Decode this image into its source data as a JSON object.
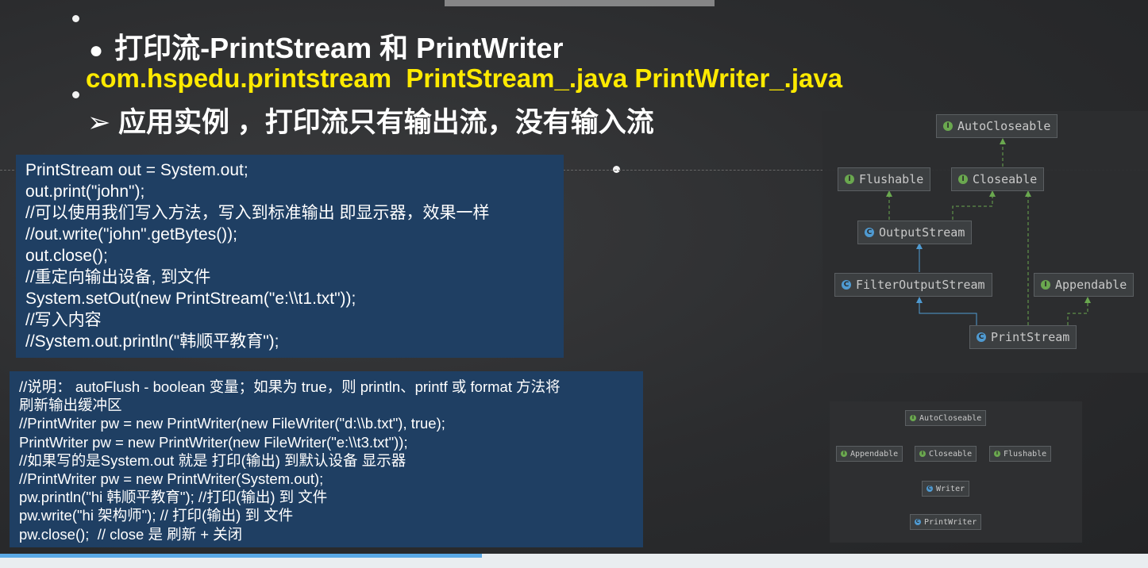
{
  "slide": {
    "title": "打印流-PrintStream 和 PrintWriter",
    "title_bullet": "●",
    "files": "com.hspedu.printstream  PrintStream_.java PrintWriter_.java",
    "subtitle": "➢ 应用实例 ，打印流只有输出流，没有输入流"
  },
  "code_block_1": {
    "lines": [
      "PrintStream out = System.out;",
      "out.print(\"john\");",
      "//可以使用我们写入方法，写入到标准输出 即显示器，效果一样",
      "//out.write(\"john\".getBytes());",
      "out.close();",
      "//重定向输出设备, 到文件",
      "System.setOut(new PrintStream(\"e:\\\\t1.txt\"));",
      "//写入内容",
      "//System.out.println(\"韩顺平教育\");"
    ]
  },
  "code_block_2": {
    "lines": [
      "//说明： autoFlush - boolean 变量；如果为 true，则 println、printf 或 format 方法将",
      "刷新输出缓冲区",
      "//PrintWriter pw = new PrintWriter(new FileWriter(\"d:\\\\b.txt\"), true);",
      "PrintWriter pw = new PrintWriter(new FileWriter(\"e:\\\\t3.txt\"));",
      "//如果写的是System.out 就是 打印(输出) 到默认设备 显示器",
      "//PrintWriter pw = new PrintWriter(System.out);",
      "pw.println(\"hi 韩顺平教育\"); //打印(输出) 到 文件",
      "pw.write(\"hi 架构师\"); // 打印(输出) 到 文件",
      "pw.close();  // close 是 刷新 + 关闭"
    ]
  },
  "diagram_1": {
    "nodes": {
      "autocloseable": {
        "label": "AutoCloseable",
        "kind": "I"
      },
      "flushable": {
        "label": "Flushable",
        "kind": "I"
      },
      "closeable": {
        "label": "Closeable",
        "kind": "I"
      },
      "outputstream": {
        "label": "OutputStream",
        "kind": "C"
      },
      "filteroutputstream": {
        "label": "FilterOutputStream",
        "kind": "C"
      },
      "appendable": {
        "label": "Appendable",
        "kind": "I"
      },
      "printstream": {
        "label": "PrintStream",
        "kind": "C"
      }
    }
  },
  "diagram_2": {
    "nodes": {
      "autocloseable": {
        "label": "AutoCloseable",
        "kind": "I"
      },
      "appendable": {
        "label": "Appendable",
        "kind": "I"
      },
      "closeable": {
        "label": "Closeable",
        "kind": "I"
      },
      "flushable": {
        "label": "Flushable",
        "kind": "I"
      },
      "writer": {
        "label": "Writer",
        "kind": "C"
      },
      "printwriter": {
        "label": "PrintWriter",
        "kind": "C"
      }
    }
  },
  "colors": {
    "code_bg": "#1f3f63",
    "highlight_yellow": "#ffea00",
    "interface_icon": "#6aa84f",
    "class_icon": "#4f9ad1",
    "progress": "#5aa9e6"
  },
  "playback": {
    "progress": 0.42
  }
}
